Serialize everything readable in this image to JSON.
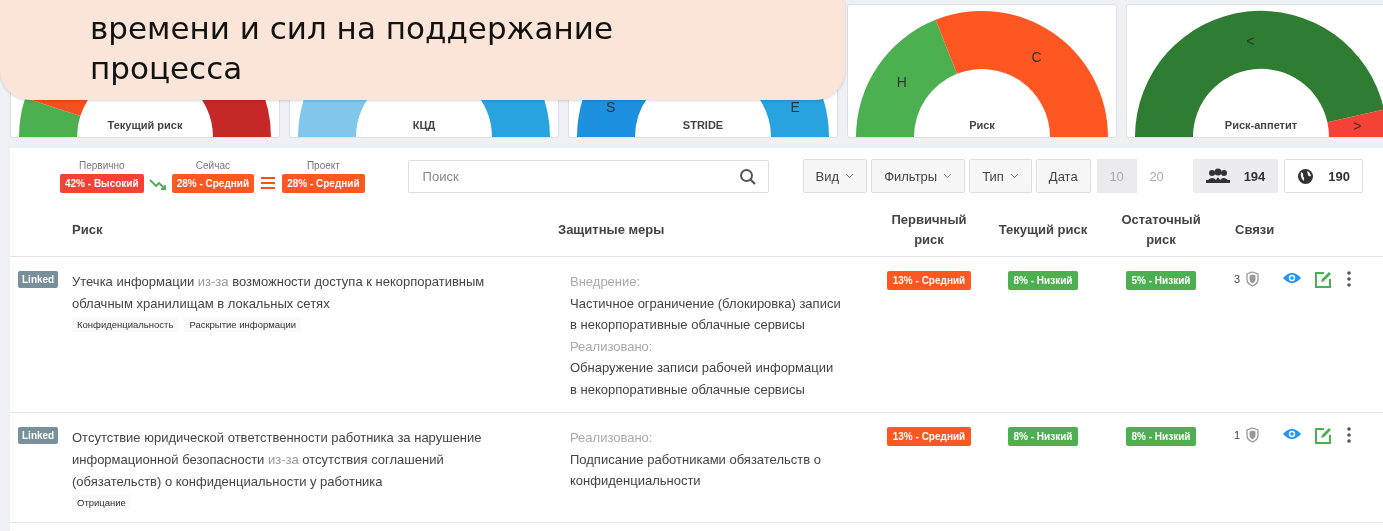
{
  "callout": {
    "text": "времени и сил на поддержание процесса"
  },
  "gauges": [
    {
      "title": "Текущий риск",
      "segments": [
        {
          "color": "#4caf50"
        },
        {
          "color": "#f4511e"
        },
        {
          "color": "#c62828"
        }
      ]
    },
    {
      "title": "КЦД",
      "segments": [
        {
          "color": "#81c7ec"
        },
        {
          "color": "#29a3e0"
        }
      ]
    },
    {
      "title": "STRIDE",
      "segments": [
        {
          "label": "S",
          "color": "#1e90e0"
        },
        {
          "label": "E",
          "color": "#29a3e0"
        }
      ]
    },
    {
      "title": "Риск",
      "segments": [
        {
          "label": "Н",
          "color": "#4caf50"
        },
        {
          "label": "С",
          "color": "#ff5722"
        }
      ]
    },
    {
      "title": "Риск-аппетит",
      "segments": [
        {
          "label": "<",
          "color": "#2e7d32"
        },
        {
          "label": ">",
          "color": "#f44336"
        }
      ]
    }
  ],
  "risk_summary": [
    {
      "label": "Первично",
      "badge": "42% - Высокий",
      "color": "#f44336"
    },
    {
      "label": "Сейчас",
      "badge": "28% - Средний",
      "color": "#ff5722"
    },
    {
      "label": "Проект",
      "badge": "28% - Средний",
      "color": "#ff5722"
    }
  ],
  "search": {
    "placeholder": "Поиск"
  },
  "filters": [
    {
      "label": "Вид",
      "dropdown": true
    },
    {
      "label": "Фильтры",
      "dropdown": true
    },
    {
      "label": "Тип",
      "dropdown": true
    },
    {
      "label": "Дата",
      "dropdown": false
    }
  ],
  "page_sizes": [
    {
      "label": "10",
      "selected": true
    },
    {
      "label": "20",
      "selected": false
    }
  ],
  "counters": [
    {
      "kind": "people",
      "value": "194",
      "selected": true
    },
    {
      "kind": "globe",
      "value": "190",
      "selected": false
    }
  ],
  "table": {
    "columns": [
      "Риск",
      "Защитные меры",
      "Первичный риск",
      "Текущий риск",
      "Остаточный риск",
      "Связи"
    ],
    "rows": [
      {
        "badge": "Linked",
        "title": [
          {
            "text": "Утечка информации ",
            "muted": false
          },
          {
            "text": "из-за",
            "muted": true
          },
          {
            "text": " возможности доступа к некорпоративным облачным хранилищам в локальных сетях",
            "muted": false
          }
        ],
        "tags": [
          "Конфиденциальность",
          "Раскрытие информации"
        ],
        "measures": [
          {
            "heading": "Внедрение:",
            "text": "Частичное ограничение (блокировка) записи в некорпоративные облачные сервисы"
          },
          {
            "heading": "Реализовано:",
            "text": "Обнаружение записи рабочей информации в некорпоративные облачные сервисы"
          }
        ],
        "primary": {
          "text": "13% - Средний",
          "color": "#ff5722"
        },
        "current": {
          "text": "8% - Низкий",
          "color": "#4caf50"
        },
        "residual": {
          "text": "5% - Низкий",
          "color": "#4caf50"
        },
        "links": "3"
      },
      {
        "badge": "Linked",
        "title": [
          {
            "text": "Отсутствие юридической ответственности работника за нарушение информационной безопасности ",
            "muted": false
          },
          {
            "text": "из-за",
            "muted": true
          },
          {
            "text": " отсутствия соглашений (обязательств) о конфиденциальности у работника",
            "muted": false
          }
        ],
        "tags": [
          "Отрицание"
        ],
        "measures": [
          {
            "heading": "Реализовано:",
            "text": "Подписание работниками обязательств о конфиденциальности"
          }
        ],
        "primary": {
          "text": "13% - Средний",
          "color": "#ff5722"
        },
        "current": {
          "text": "8% - Низкий",
          "color": "#4caf50"
        },
        "residual": {
          "text": "8% - Низкий",
          "color": "#4caf50"
        },
        "links": "1"
      }
    ]
  }
}
